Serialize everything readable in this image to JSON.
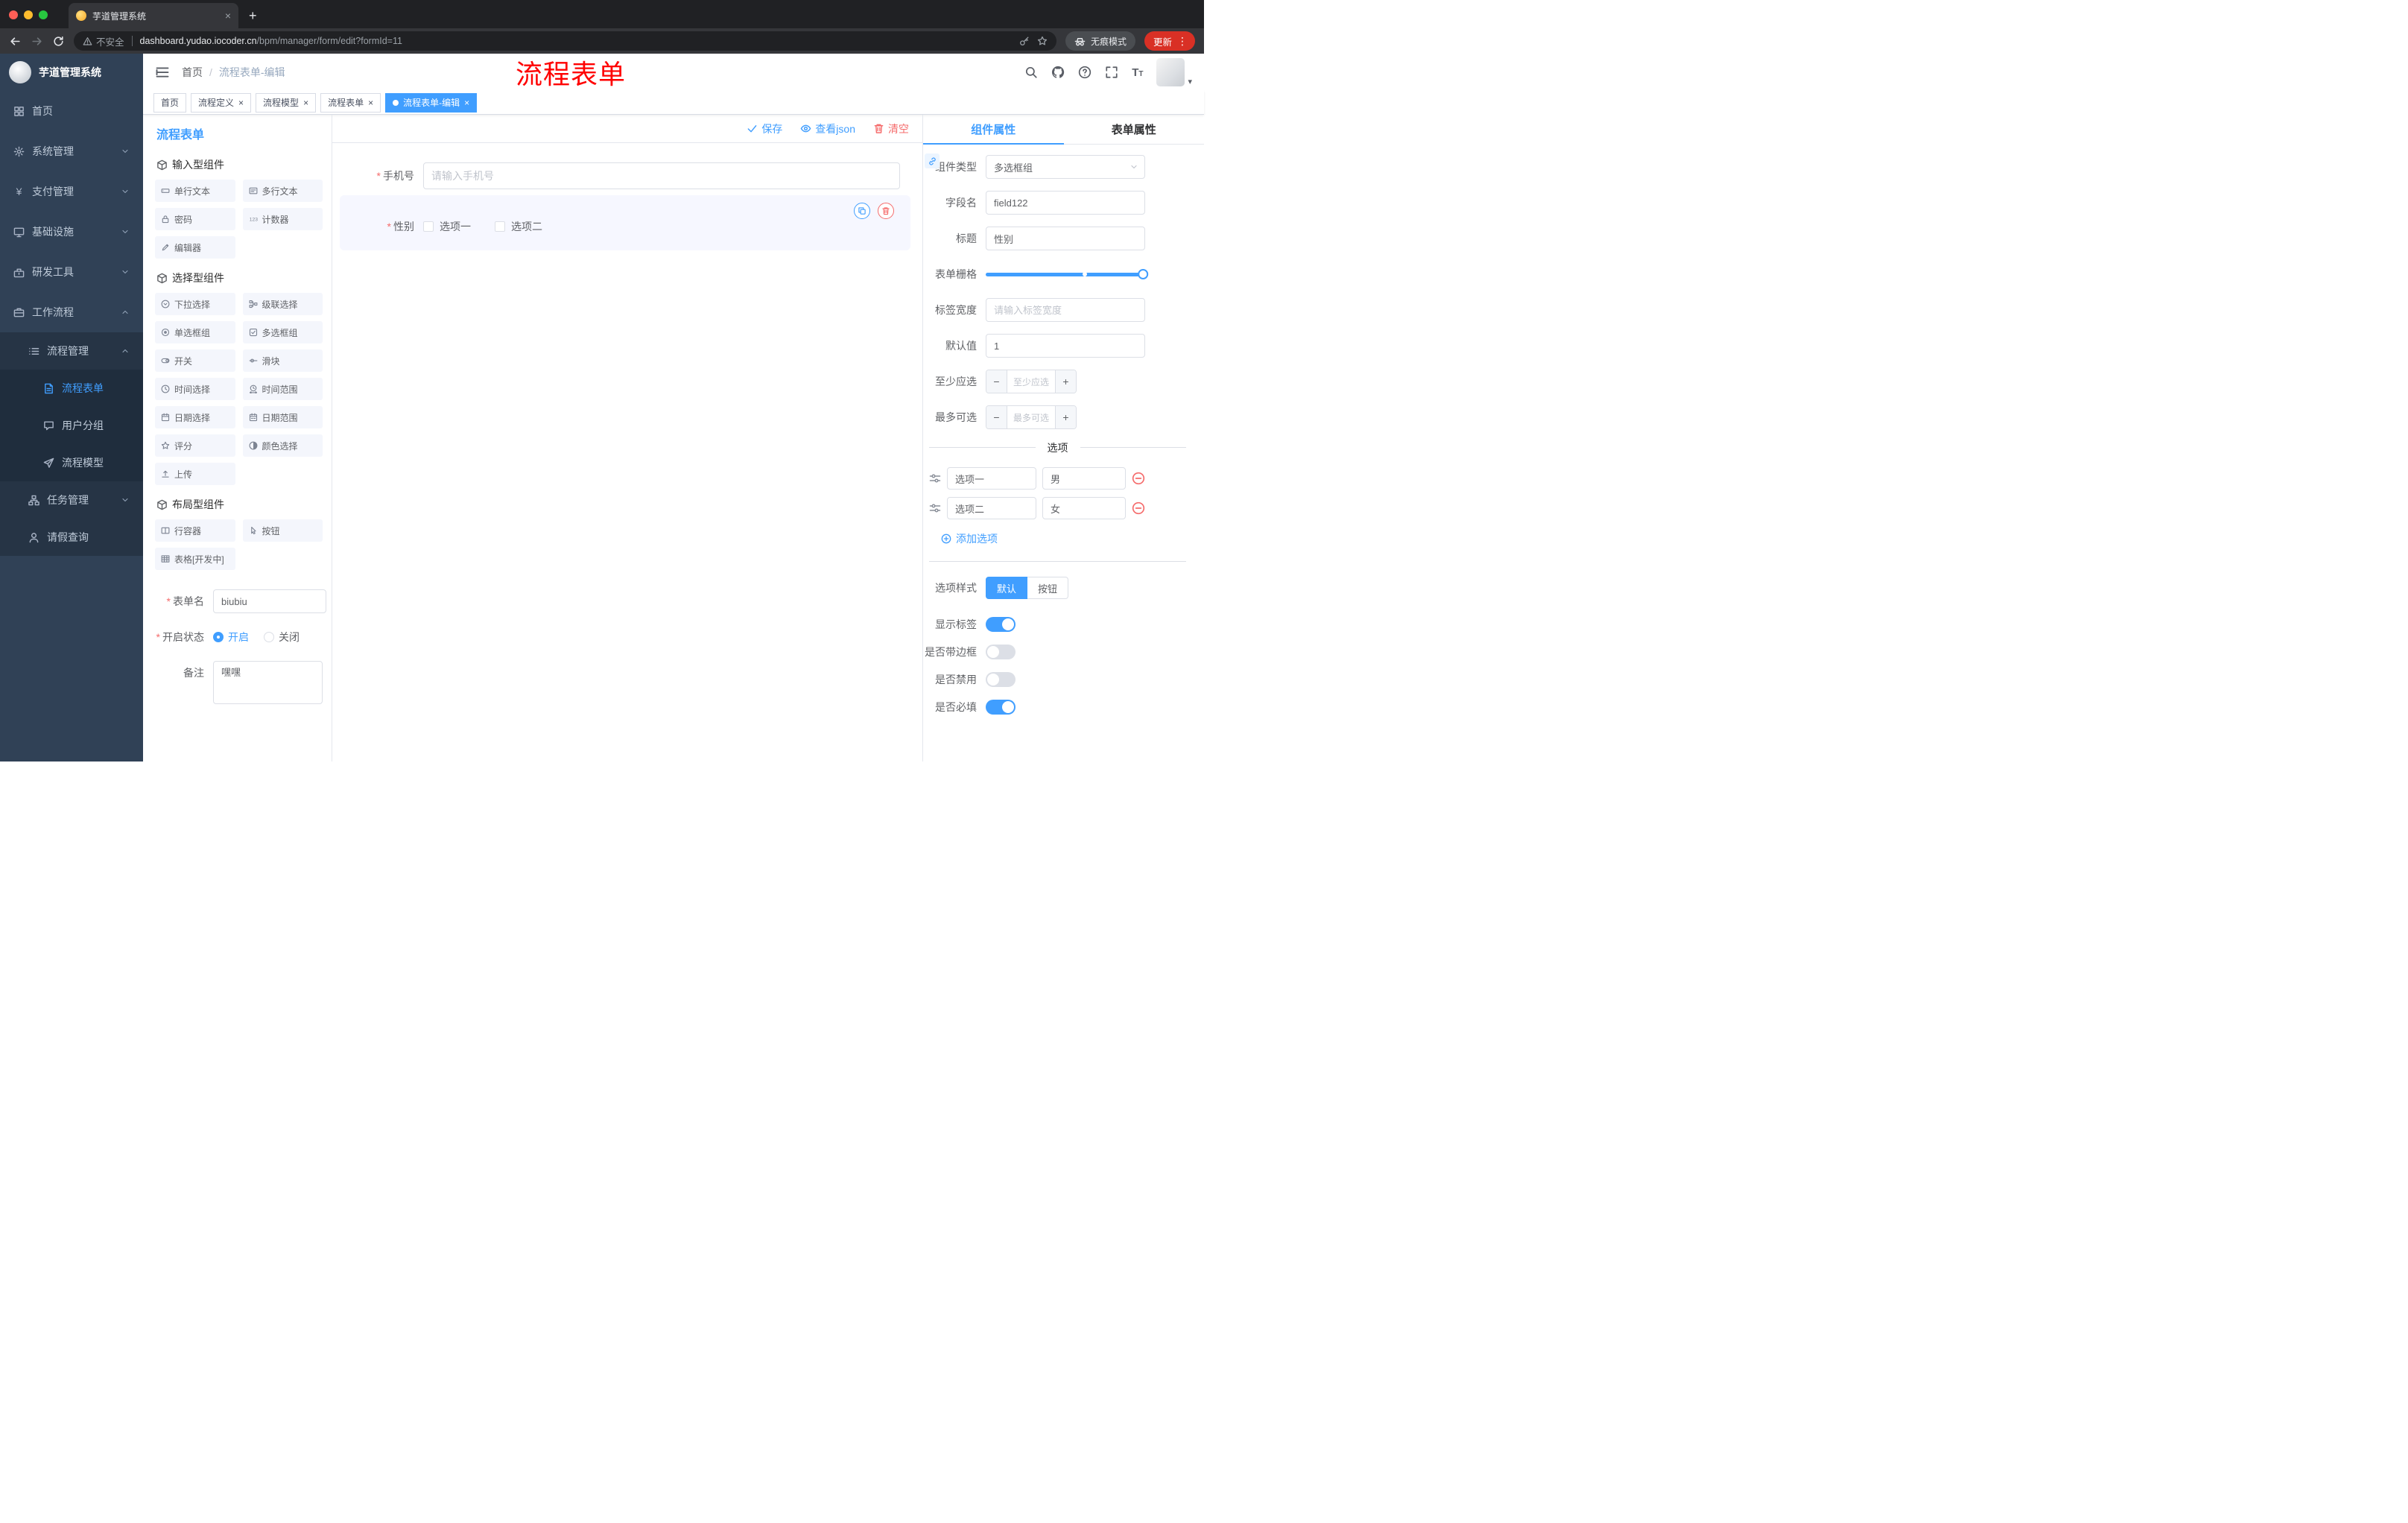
{
  "browser": {
    "tab_title": "芋道管理系统",
    "security": "不安全",
    "url_host": "dashboard.yudao.iocoder.cn",
    "url_path": "/bpm/manager/form/edit?formId=11",
    "incognito": "无痕模式",
    "update": "更新"
  },
  "sidebar": {
    "logo": "芋道管理系统",
    "home": "首页",
    "system": "系统管理",
    "payment": "支付管理",
    "infra": "基础设施",
    "devtools": "研发工具",
    "workflow": "工作流程",
    "process_mgmt": "流程管理",
    "process_form": "流程表单",
    "user_group": "用户分组",
    "process_model": "流程模型",
    "task_mgmt": "任务管理",
    "leave_query": "请假查询"
  },
  "navbar": {
    "breadcrumb_home": "首页",
    "breadcrumb_current": "流程表单-编辑",
    "watermark": "流程表单"
  },
  "tags": [
    "首页",
    "流程定义",
    "流程模型",
    "流程表单",
    "流程表单-编辑"
  ],
  "palette": {
    "title": "流程表单",
    "group1_title": "输入型组件",
    "group1": [
      "单行文本",
      "多行文本",
      "密码",
      "计数器",
      "编辑器"
    ],
    "group2_title": "选择型组件",
    "group2": [
      "下拉选择",
      "级联选择",
      "单选框组",
      "多选框组",
      "开关",
      "滑块",
      "时间选择",
      "时间范围",
      "日期选择",
      "日期范围",
      "评分",
      "颜色选择",
      "上传"
    ],
    "group3_title": "布局型组件",
    "group3": [
      "行容器",
      "按钮",
      "表格[开发中]"
    ],
    "meta": {
      "form_name_label": "表单名",
      "form_name_value": "biubiu",
      "status_label": "开启状态",
      "status_on": "开启",
      "status_off": "关闭",
      "remark_label": "备注",
      "remark_value": "嘿嘿"
    }
  },
  "toolbar": {
    "save": "保存",
    "view_json": "查看json",
    "clear": "清空"
  },
  "canvas": {
    "phone_label": "手机号",
    "phone_placeholder": "请输入手机号",
    "gender_label": "性别",
    "gender_option1": "选项一",
    "gender_option2": "选项二"
  },
  "props": {
    "tab_component": "组件属性",
    "tab_form": "表单属性",
    "component_type_label": "组件类型",
    "component_type_value": "多选框组",
    "field_name_label": "字段名",
    "field_name_value": "field122",
    "title_label": "标题",
    "title_value": "性别",
    "grid_label": "表单栅格",
    "label_width_label": "标签宽度",
    "label_width_placeholder": "请输入标签宽度",
    "default_label": "默认值",
    "default_value": "1",
    "min_label": "至少应选",
    "min_placeholder": "至少应选",
    "max_label": "最多可选",
    "max_placeholder": "最多可选",
    "options_title": "选项",
    "options": [
      {
        "label": "选项一",
        "value": "男"
      },
      {
        "label": "选项二",
        "value": "女"
      }
    ],
    "add_option": "添加选项",
    "option_style_label": "选项样式",
    "option_style_default": "默认",
    "option_style_button": "按钮",
    "switches": [
      {
        "label": "显示标签",
        "on": true
      },
      {
        "label": "是否带边框",
        "on": false
      },
      {
        "label": "是否禁用",
        "on": false
      },
      {
        "label": "是否必填",
        "on": true
      }
    ]
  },
  "colors": {
    "accent": "#409EFF",
    "danger": "#F56C6C",
    "watermark": "#FF0000",
    "sidebar_bg": "#304156"
  }
}
